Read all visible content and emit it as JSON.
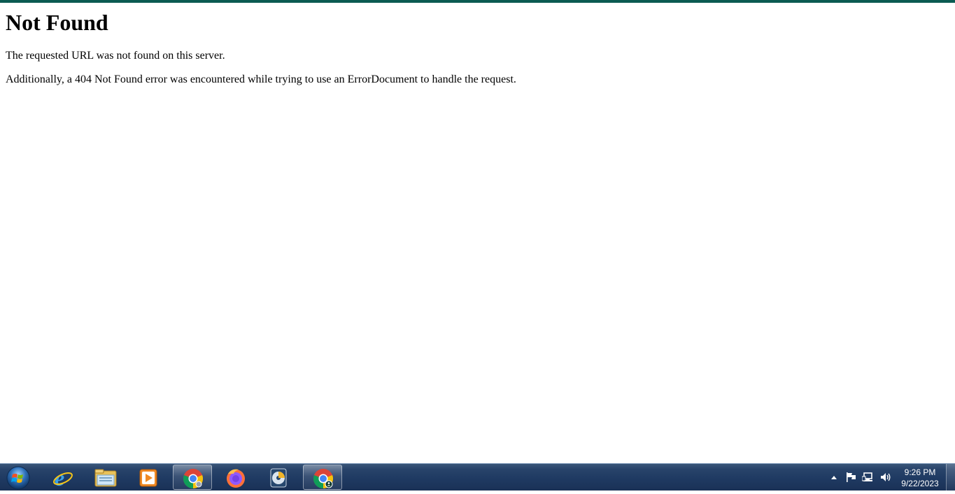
{
  "browser": {
    "accent_color": "#0b5b52"
  },
  "page": {
    "heading": "Not Found",
    "message": "The requested URL was not found on this server.",
    "detail": "Additionally, a 404 Not Found error was encountered while trying to use an ErrorDocument to handle the request."
  },
  "taskbar": {
    "start_icon": "windows-orb-icon",
    "pinned": [
      {
        "icon": "internet-explorer-icon",
        "active": false
      },
      {
        "icon": "file-explorer-icon",
        "active": false
      },
      {
        "icon": "media-player-icon",
        "active": false
      },
      {
        "icon": "chrome-icon",
        "active": true
      },
      {
        "icon": "firefox-icon",
        "active": false
      },
      {
        "icon": "media-center-icon",
        "active": false
      },
      {
        "icon": "chrome-profile-icon",
        "active": true
      }
    ],
    "tray": {
      "icons": [
        "show-hidden-icons-icon",
        "action-center-flag-icon",
        "network-icon",
        "volume-icon"
      ],
      "time": "9:26 PM",
      "date": "9/22/2023"
    }
  }
}
